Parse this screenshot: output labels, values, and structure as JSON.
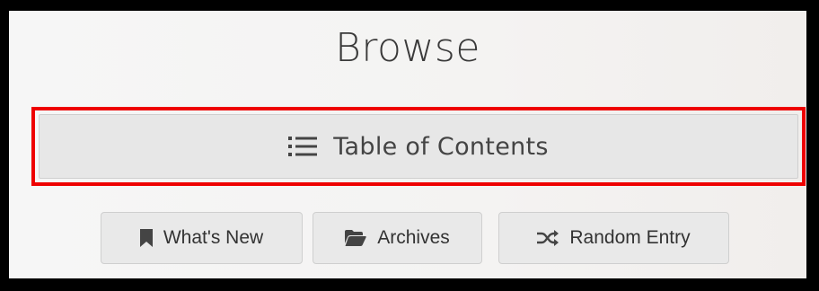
{
  "browse": {
    "title": "Browse",
    "table_of_contents": {
      "label": "Table of Contents",
      "icon": "list-icon"
    },
    "nav_buttons": [
      {
        "label": "What's New",
        "icon": "bookmark-icon"
      },
      {
        "label": "Archives",
        "icon": "folder-open-icon"
      },
      {
        "label": "Random Entry",
        "icon": "shuffle-icon"
      }
    ]
  },
  "colors": {
    "highlight": "#ee0000",
    "button_bg": "#e7e7e7",
    "text": "#444444"
  }
}
